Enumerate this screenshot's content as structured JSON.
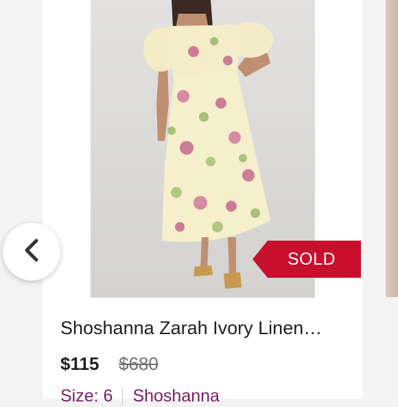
{
  "listing": {
    "title": "Shoshanna Zarah Ivory Linen…",
    "price": "$115",
    "original_price": "$680",
    "size": "Size: 6",
    "brand": "Shoshanna",
    "sold_badge": "SOLD"
  },
  "icons": {
    "previous": "chevron-left-icon"
  },
  "colors": {
    "sold_badge": "#c8102e",
    "meta_text": "#7a1d6b"
  }
}
